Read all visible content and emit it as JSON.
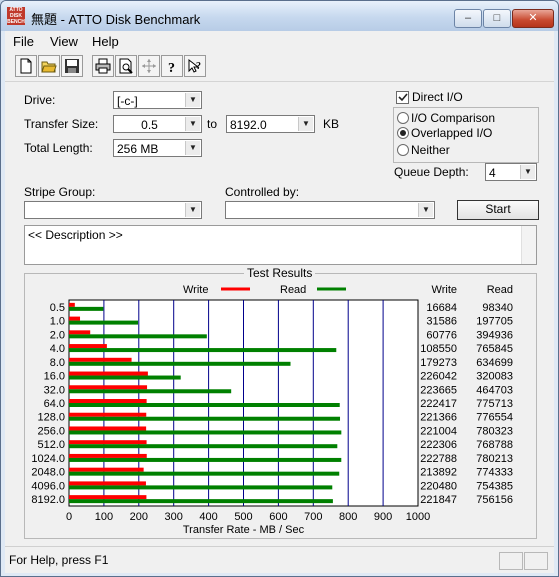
{
  "window": {
    "title": "無題 - ATTO Disk Benchmark",
    "icon_text": "ATTO DISK BENCH"
  },
  "menu": [
    "File",
    "View",
    "Help"
  ],
  "toolbar": [
    "new-icon",
    "open-icon",
    "save-icon",
    "print-icon",
    "print-preview-icon",
    "move-icon",
    "help-icon",
    "context-help-icon"
  ],
  "form": {
    "drive_label": "Drive:",
    "drive_value": "[-c-]",
    "transfer_size_label": "Transfer Size:",
    "transfer_from": "0.5",
    "transfer_to_label": "to",
    "transfer_to": "8192.0",
    "transfer_unit": "KB",
    "total_length_label": "Total Length:",
    "total_length": "256 MB",
    "direct_io_label": "Direct I/O",
    "io_comparison_label": "I/O Comparison",
    "overlapped_io_label": "Overlapped I/O",
    "neither_label": "Neither",
    "queue_depth_label": "Queue Depth:",
    "queue_depth": "4",
    "stripe_group_label": "Stripe Group:",
    "stripe_group": "",
    "controlled_by_label": "Controlled by:",
    "controlled_by": "",
    "start_label": "Start",
    "description": "<< Description >>"
  },
  "colors": {
    "write": "#ff0000",
    "read": "#008000",
    "gridline": "#00008b"
  },
  "results": {
    "title": "Test Results",
    "write_legend": "Write",
    "read_legend": "Read",
    "write_col": "Write",
    "read_col": "Read",
    "x_label": "Transfer Rate - MB / Sec"
  },
  "chart_data": {
    "type": "bar",
    "orientation": "horizontal",
    "xlabel": "Transfer Rate - MB / Sec",
    "xlim": [
      0,
      1000
    ],
    "x_ticks": [
      0,
      100,
      200,
      300,
      400,
      500,
      600,
      700,
      800,
      900,
      1000
    ],
    "categories": [
      "0.5",
      "1.0",
      "2.0",
      "4.0",
      "8.0",
      "16.0",
      "32.0",
      "64.0",
      "128.0",
      "256.0",
      "512.0",
      "1024.0",
      "2048.0",
      "4096.0",
      "8192.0"
    ],
    "series": [
      {
        "name": "Write",
        "values": [
          16.684,
          31.586,
          60.776,
          108.55,
          179.273,
          226.042,
          223.665,
          222.417,
          221.366,
          221.004,
          222.306,
          222.788,
          213.892,
          220.48,
          221.847
        ],
        "raw": [
          "16684",
          "31586",
          "60776",
          "108550",
          "179273",
          "226042",
          "223665",
          "222417",
          "221366",
          "221004",
          "222306",
          "222788",
          "213892",
          "220480",
          "221847"
        ]
      },
      {
        "name": "Read",
        "values": [
          98.34,
          197.705,
          394.936,
          765.845,
          634.699,
          320.083,
          464.703,
          775.713,
          776.554,
          780.323,
          768.788,
          780.213,
          774.333,
          754.385,
          756.156
        ],
        "raw": [
          "98340",
          "197705",
          "394936",
          "765845",
          "634699",
          "320083",
          "464703",
          "775713",
          "776554",
          "780323",
          "768788",
          "780213",
          "774333",
          "754385",
          "756156"
        ]
      }
    ]
  },
  "status": {
    "text": "For Help, press F1"
  }
}
